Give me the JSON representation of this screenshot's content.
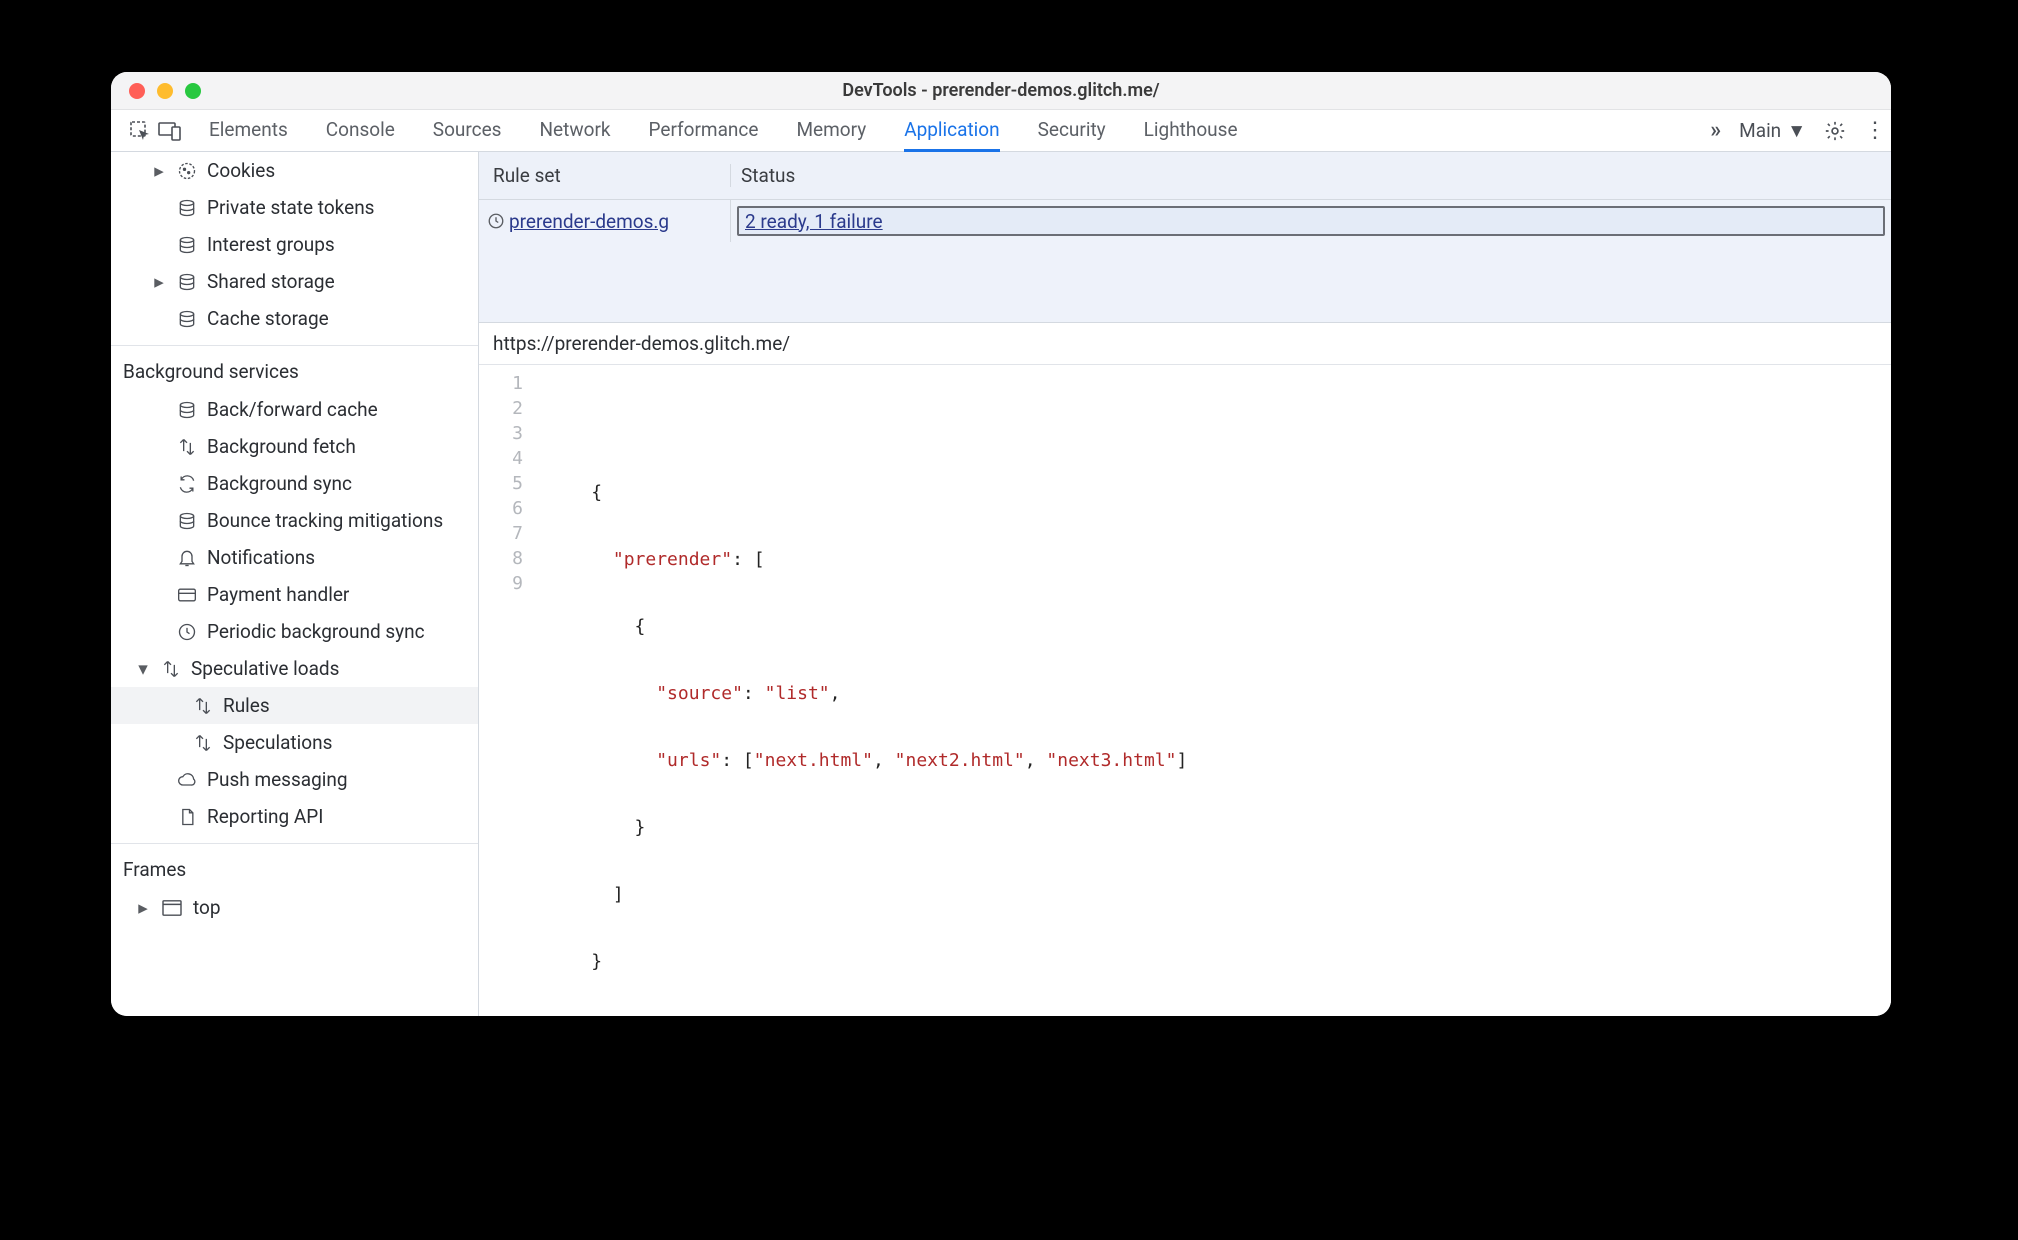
{
  "window": {
    "title": "DevTools - prerender-demos.glitch.me/"
  },
  "tabs": {
    "elements": "Elements",
    "console": "Console",
    "sources": "Sources",
    "network": "Network",
    "performance": "Performance",
    "memory": "Memory",
    "application": "Application",
    "security": "Security",
    "lighthouse": "Lighthouse"
  },
  "tabbar_right": {
    "main": "Main"
  },
  "sidebar": {
    "storage": {
      "cookies": "Cookies",
      "private_state_tokens": "Private state tokens",
      "interest_groups": "Interest groups",
      "shared_storage": "Shared storage",
      "cache_storage": "Cache storage"
    },
    "background_services_title": "Background services",
    "bg": {
      "bfcache": "Back/forward cache",
      "bgfetch": "Background fetch",
      "bgsync": "Background sync",
      "bounce": "Bounce tracking mitigations",
      "notifications": "Notifications",
      "payment": "Payment handler",
      "periodic": "Periodic background sync",
      "speculative": "Speculative loads",
      "rules": "Rules",
      "speculations": "Speculations",
      "push": "Push messaging",
      "reporting": "Reporting API"
    },
    "frames_title": "Frames",
    "frames_top": "top"
  },
  "table": {
    "header_ruleset": "Rule set",
    "header_status": "Status",
    "row_ruleset": " prerender-demos.g",
    "row_status": "2 ready, 1 failure"
  },
  "detail": {
    "url": "https://prerender-demos.glitch.me/",
    "code": {
      "l1": "",
      "l2_brace": "{",
      "l3_key": "\"prerender\"",
      "l3_rest": ": [",
      "l4_brace": "{",
      "l5_key": "\"source\"",
      "l5_val": "\"list\"",
      "l6_key": "\"urls\"",
      "l6_v1": "\"next.html\"",
      "l6_v2": "\"next2.html\"",
      "l6_v3": "\"next3.html\"",
      "l7_close": "}",
      "l8_close": "]",
      "l9_close": "}"
    }
  }
}
